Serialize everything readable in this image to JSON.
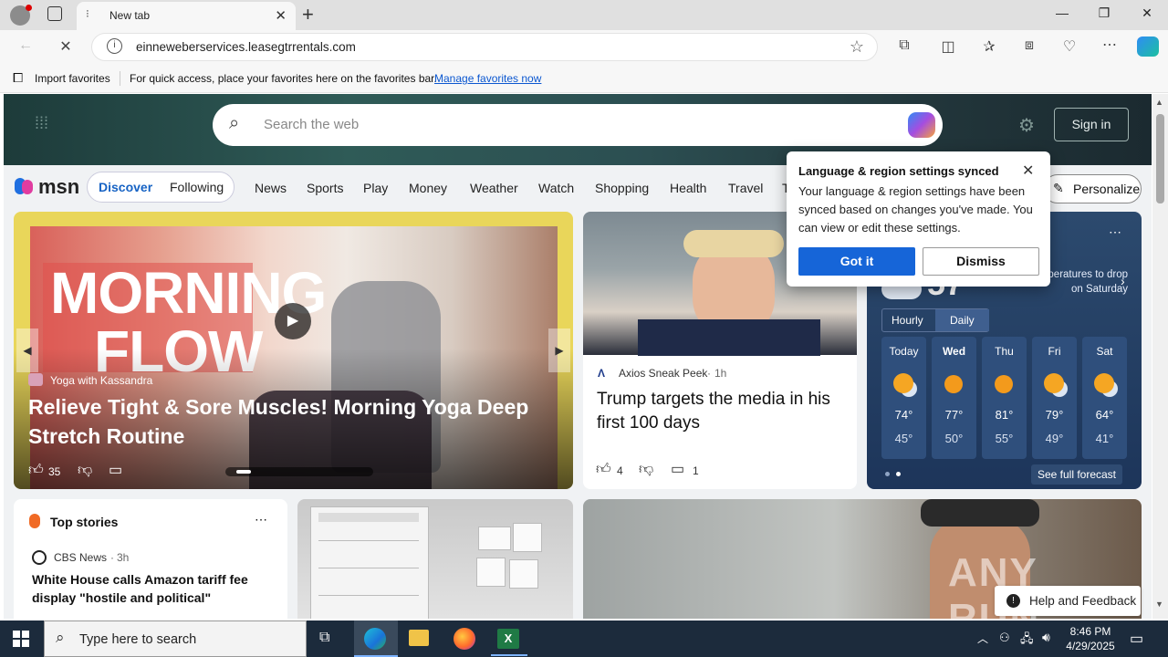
{
  "browser": {
    "tab_title": "New tab",
    "url": "einneweberservices.leasegtrrentals.com"
  },
  "favorites_bar": {
    "import_label": "Import favorites",
    "message": "For quick access, place your favorites here on the favorites bar.",
    "manage_link": "Manage favorites now"
  },
  "msn": {
    "search_placeholder": "Search the web",
    "sign_in": "Sign in",
    "logo": "msn",
    "pill": [
      "Discover",
      "Following"
    ],
    "nav": [
      "News",
      "Sports",
      "Play",
      "Money",
      "Weather",
      "Watch",
      "Shopping",
      "Health",
      "Travel",
      "T"
    ],
    "personalize": "Personalize"
  },
  "feature": {
    "overlay_line1": "MORNING",
    "overlay_line2": "FLOW",
    "source": "Yoga with Kassandra",
    "title": "Relieve Tight & Sore Muscles! Morning Yoga Deep Stretch Routine",
    "likes": "35"
  },
  "story2": {
    "source": "Axios Sneak Peek",
    "age": "1h",
    "title": "Trump targets the media in his first 100 days",
    "likes": "4",
    "comments": "1"
  },
  "weather": {
    "temp": "57",
    "alert": "...peratures to drop on Saturday",
    "tabs": [
      "Hourly",
      "Daily"
    ],
    "days": [
      {
        "day": "Today",
        "hi": "74°",
        "lo": "45°"
      },
      {
        "day": "Wed",
        "hi": "77°",
        "lo": "50°"
      },
      {
        "day": "Thu",
        "hi": "81°",
        "lo": "55°"
      },
      {
        "day": "Fri",
        "hi": "79°",
        "lo": "49°"
      },
      {
        "day": "Sat",
        "hi": "64°",
        "lo": "41°"
      }
    ],
    "full_forecast": "See full forecast"
  },
  "popup": {
    "title": "Language & region settings synced",
    "body": "Your language & region settings have been synced based on changes you've made. You can view or edit these settings.",
    "got_it": "Got it",
    "dismiss": "Dismiss"
  },
  "top_stories": {
    "heading": "Top stories",
    "source": "CBS News",
    "age": "3h",
    "headline": "White House calls Amazon tariff fee display \"hostile and political\""
  },
  "feedback": "Help and Feedback",
  "watermark": "ANY RUN",
  "taskbar": {
    "search_placeholder": "Type here to search",
    "time": "8:46 PM",
    "date": "4/29/2025"
  }
}
